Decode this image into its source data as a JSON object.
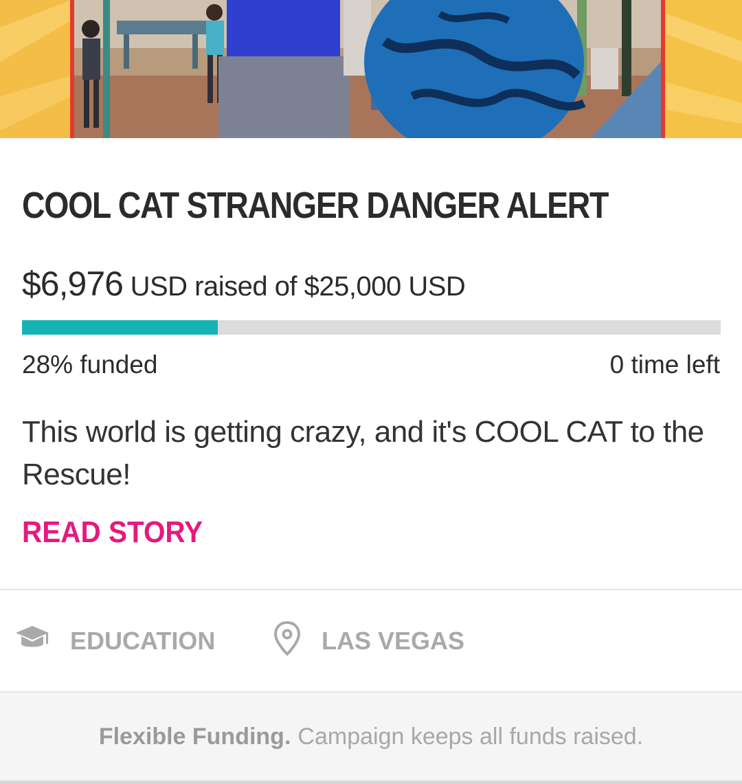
{
  "campaign": {
    "title": "COOL CAT STRANGER DANGER ALERT",
    "raised_amount": "$6,976",
    "raised_suffix": "USD raised of $25,000 USD",
    "progress_fraction": 0.28,
    "funded_percent": "28%",
    "funded_label": "funded",
    "time_value": "0",
    "time_label": "time left",
    "blurb": "This world is getting crazy, and it's COOL CAT to the Rescue!",
    "read_story_label": "READ STORY"
  },
  "meta": {
    "category": {
      "label": "EDUCATION",
      "icon": "graduation-cap-icon"
    },
    "location": {
      "label": "LAS VEGAS",
      "icon": "map-pin-icon"
    }
  },
  "footer": {
    "funding_type": "Flexible Funding.",
    "funding_note": "Campaign keeps all funds raised."
  },
  "colors": {
    "accent_teal": "#16b3b5",
    "accent_pink": "#e5197e",
    "muted_gray": "#a9a9a9"
  }
}
